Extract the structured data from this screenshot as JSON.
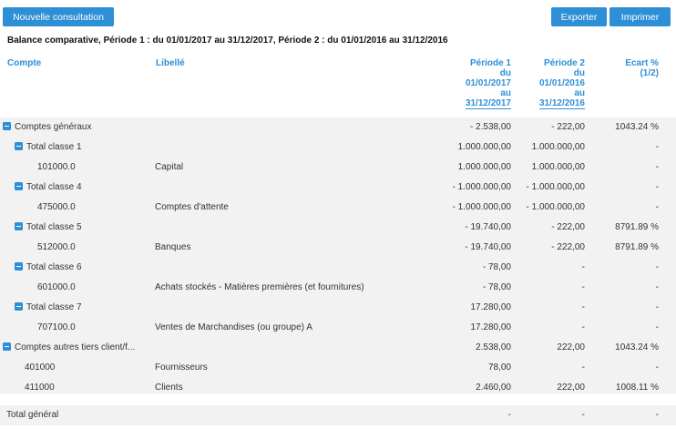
{
  "toolbar": {
    "new_label": "Nouvelle consultation",
    "export_label": "Exporter",
    "print_label": "Imprimer"
  },
  "report": {
    "title": "Balance comparative, Période 1 : du 01/01/2017 au 31/12/2017, Période 2 : du 01/01/2016 au 31/12/2016"
  },
  "columns": {
    "compte": "Compte",
    "libelle": "Libellé",
    "p1": [
      "Période 1",
      "du",
      "01/01/2017",
      "au",
      "31/12/2017"
    ],
    "p2": [
      "Période 2",
      "du",
      "01/01/2016",
      "au",
      "31/12/2016"
    ],
    "ecart": [
      "Ecart %",
      "(1/2)"
    ]
  },
  "rows": [
    {
      "compte": "Comptes généraux",
      "libelle": "",
      "p1": "- 2.538,00",
      "p2": "- 222,00",
      "ecart": "1043.24 %"
    },
    {
      "compte": "Total classe 1",
      "libelle": "",
      "p1": "1.000.000,00",
      "p2": "1.000.000,00",
      "ecart": "-"
    },
    {
      "compte": "101000.0",
      "libelle": "Capital",
      "p1": "1.000.000,00",
      "p2": "1.000.000,00",
      "ecart": "-"
    },
    {
      "compte": "Total classe 4",
      "libelle": "",
      "p1": "- 1.000.000,00",
      "p2": "- 1.000.000,00",
      "ecart": "-"
    },
    {
      "compte": "475000.0",
      "libelle": "Comptes d'attente",
      "p1": "- 1.000.000,00",
      "p2": "- 1.000.000,00",
      "ecart": "-"
    },
    {
      "compte": "Total classe 5",
      "libelle": "",
      "p1": "- 19.740,00",
      "p2": "- 222,00",
      "ecart": "8791.89 %"
    },
    {
      "compte": "512000.0",
      "libelle": "Banques",
      "p1": "- 19.740,00",
      "p2": "- 222,00",
      "ecart": "8791.89 %"
    },
    {
      "compte": "Total classe 6",
      "libelle": "",
      "p1": "- 78,00",
      "p2": "-",
      "ecart": "-"
    },
    {
      "compte": "601000.0",
      "libelle": "Achats stockés - Matières premières (et fournitures)",
      "p1": "- 78,00",
      "p2": "-",
      "ecart": "-"
    },
    {
      "compte": "Total classe 7",
      "libelle": "",
      "p1": "17.280,00",
      "p2": "-",
      "ecart": "-"
    },
    {
      "compte": "707100.0",
      "libelle": "Ventes de Marchandises (ou groupe) A",
      "p1": "17.280,00",
      "p2": "-",
      "ecart": "-"
    },
    {
      "compte": "Comptes autres tiers client/f...",
      "libelle": "",
      "p1": "2.538,00",
      "p2": "222,00",
      "ecart": "1043.24 %"
    },
    {
      "compte": "401000",
      "libelle": "Fournisseurs",
      "p1": "78,00",
      "p2": "-",
      "ecart": "-"
    },
    {
      "compte": "411000",
      "libelle": "Clients",
      "p1": "2.460,00",
      "p2": "222,00",
      "ecart": "1008.11 %"
    }
  ],
  "total": {
    "compte": "Total général",
    "p1": "-",
    "p2": "-",
    "ecart": "-"
  },
  "colors": {
    "accent": "#2d8fd5",
    "row_bg": "#f2f2f2"
  }
}
